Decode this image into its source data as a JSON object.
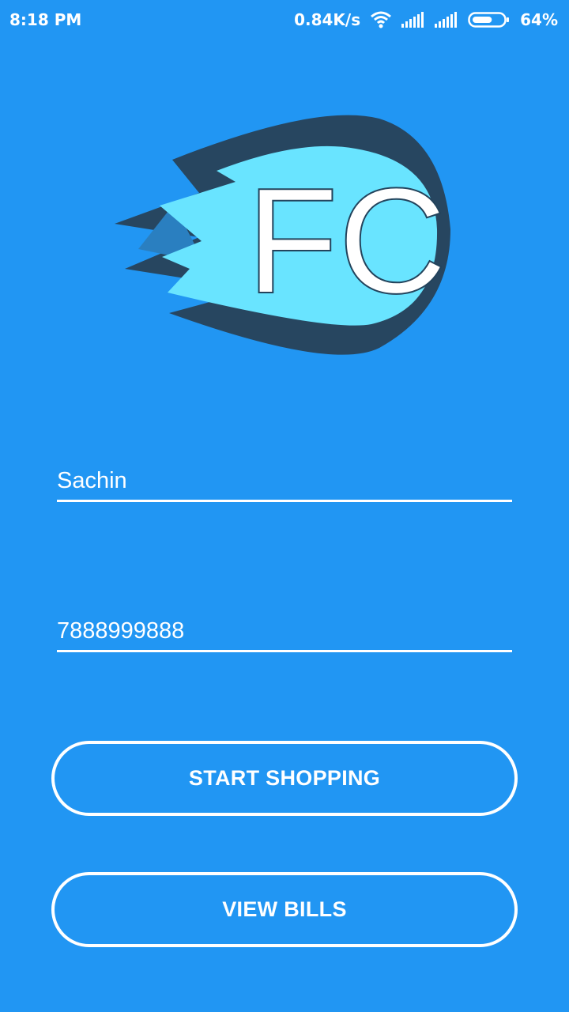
{
  "status_bar": {
    "time": "8:18 PM",
    "network_speed": "0.84K/s",
    "battery_percent": "64%",
    "battery_level": 0.64,
    "icons": [
      "wifi-icon",
      "signal-icon",
      "signal-icon",
      "battery-icon"
    ]
  },
  "logo": {
    "text": "FC",
    "colors": {
      "dark": "#274660",
      "mid": "#2A7FC0",
      "light": "#69E4FF",
      "letters": "#ffffff"
    }
  },
  "form": {
    "name_value": "Sachin",
    "phone_value": "7888999888"
  },
  "buttons": {
    "start_shopping": "START SHOPPING",
    "view_bills": "VIEW BILLS"
  },
  "colors": {
    "background": "#2196F3",
    "foreground": "#ffffff"
  }
}
